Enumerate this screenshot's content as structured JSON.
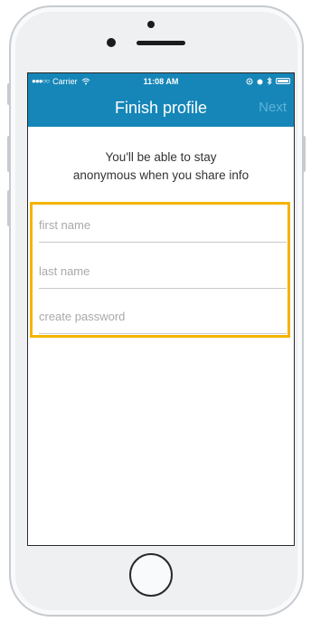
{
  "status_bar": {
    "carrier": "Carrier",
    "time": "11:08 AM"
  },
  "nav": {
    "title": "Finish profile",
    "next_label": "Next"
  },
  "subtitle": {
    "line1": "You'll be able to stay",
    "line2": "anonymous when you share info"
  },
  "form": {
    "first_name_placeholder": "first name",
    "last_name_placeholder": "last name",
    "password_placeholder": "create password"
  },
  "colors": {
    "nav_bg": "#1686b8",
    "highlight_border": "#f4b400"
  }
}
